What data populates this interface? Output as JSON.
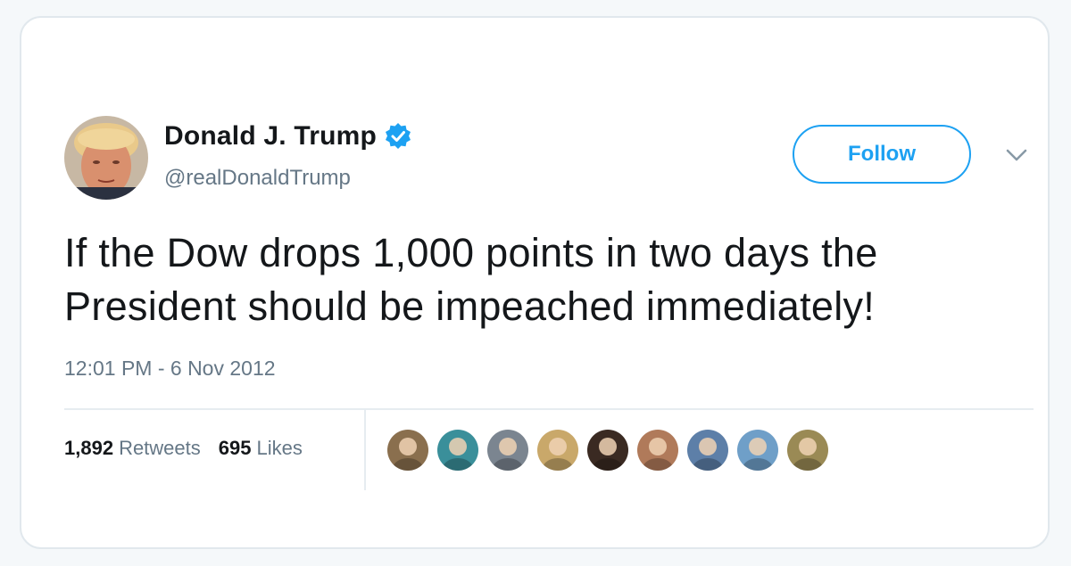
{
  "user": {
    "display_name": "Donald J. Trump",
    "handle": "@realDonaldTrump",
    "verified": true,
    "avatar_icon": "profile-photo"
  },
  "actions": {
    "follow_label": "Follow",
    "menu_icon": "chevron-down-icon"
  },
  "tweet": {
    "text": "If the Dow drops 1,000 points in two days the President should be impeached immediately!",
    "timestamp": "12:01 PM - 6 Nov 2012"
  },
  "stats": {
    "retweets_count": "1,892",
    "retweets_label": "Retweets",
    "likes_count": "695",
    "likes_label": "Likes"
  },
  "likers": [
    {
      "name": "liker-1",
      "color": "#8a6f4e"
    },
    {
      "name": "liker-2",
      "color": "#3a8f9a"
    },
    {
      "name": "liker-3",
      "color": "#7b8590"
    },
    {
      "name": "liker-4",
      "color": "#c9a86a"
    },
    {
      "name": "liker-5",
      "color": "#3a2a22"
    },
    {
      "name": "liker-6",
      "color": "#b07a5a"
    },
    {
      "name": "liker-7",
      "color": "#5d7fa8"
    },
    {
      "name": "liker-8",
      "color": "#6f9fc8"
    },
    {
      "name": "liker-9",
      "color": "#9a8a55"
    }
  ],
  "colors": {
    "brand_blue": "#1da1f2",
    "text_primary": "#14171a",
    "text_secondary": "#657786"
  }
}
